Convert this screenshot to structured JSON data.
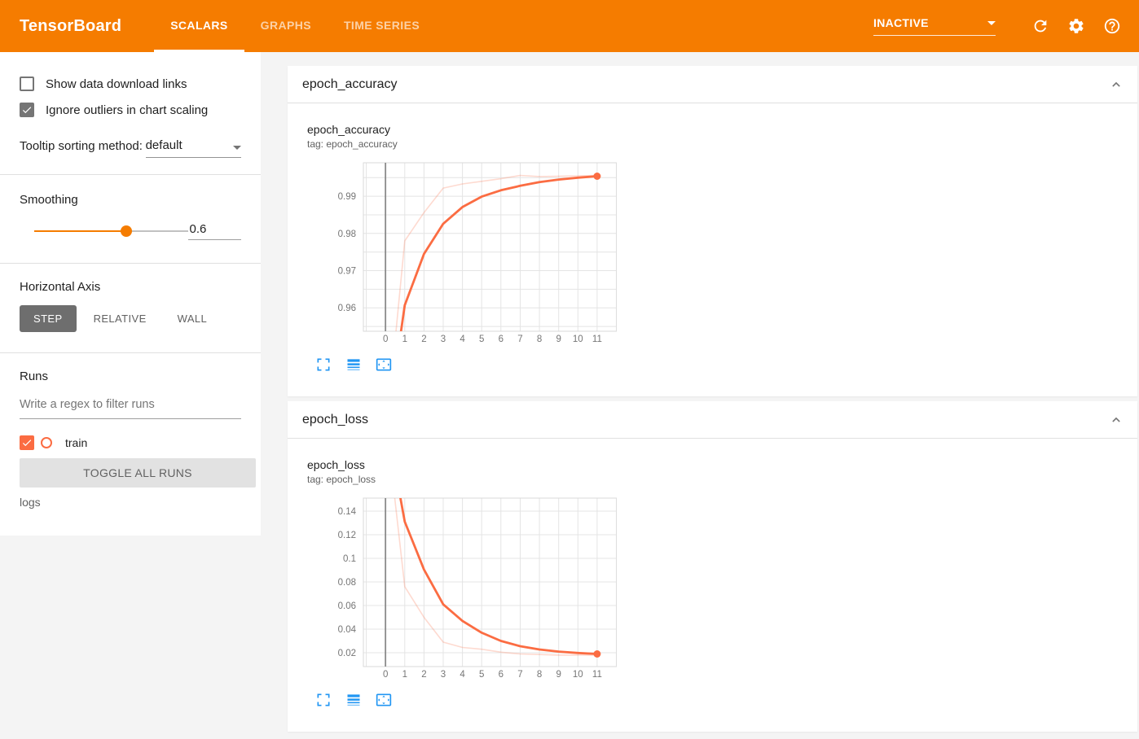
{
  "topbar": {
    "title": "TensorBoard",
    "tabs": [
      {
        "label": "SCALARS",
        "active": true
      },
      {
        "label": "GRAPHS",
        "active": false
      },
      {
        "label": "TIME SERIES",
        "active": false
      }
    ],
    "status_value": "INACTIVE",
    "icons": [
      "dropdown-caret",
      "refresh-icon",
      "settings-gear-icon",
      "help-question-icon"
    ]
  },
  "sidebar": {
    "checkboxes": [
      {
        "label": "Show data download links",
        "checked": false
      },
      {
        "label": "Ignore outliers in chart scaling",
        "checked": true
      }
    ],
    "tooltip_sorting": {
      "label": "Tooltip sorting method:",
      "value": "default"
    },
    "smoothing": {
      "label": "Smoothing",
      "value": "0.6",
      "fraction": 0.6
    },
    "horizontal_axis": {
      "label": "Horizontal Axis",
      "options": [
        {
          "label": "STEP",
          "active": true
        },
        {
          "label": "RELATIVE",
          "active": false
        },
        {
          "label": "WALL",
          "active": false
        }
      ]
    },
    "runs": {
      "label": "Runs",
      "filter_placeholder": "Write a regex to filter runs",
      "items": [
        {
          "name": "train",
          "checked": true,
          "color": "#fb6c42"
        }
      ],
      "toggle_all_label": "TOGGLE ALL RUNS",
      "logdir": "logs"
    }
  },
  "sections": [
    {
      "title": "epoch_accuracy"
    },
    {
      "title": "epoch_loss"
    }
  ],
  "colors": {
    "topbar": "#f57c00",
    "accent": "#f57c00",
    "run": "#fb6c42",
    "action_icon_blue": "#2196f3",
    "grid": "#e4e4e4",
    "axis_line": "#8a8a8a",
    "tick_text": "#757575"
  },
  "chart_data": [
    {
      "type": "line",
      "title": "epoch_accuracy",
      "tag": "tag: epoch_accuracy",
      "xlabel": "step",
      "x": [
        0,
        1,
        2,
        3,
        4,
        5,
        6,
        7,
        8,
        9,
        10,
        11
      ],
      "series": [
        {
          "name": "train",
          "style": "raw",
          "opacity": 0.25,
          "values": [
            0.9247,
            0.978,
            0.9856,
            0.9922,
            0.9933,
            0.994,
            0.9947,
            0.9956,
            0.9953,
            0.9954,
            0.9955,
            0.9956
          ]
        },
        {
          "name": "train (smoothed 0.6)",
          "style": "smoothed",
          "opacity": 1,
          "values": [
            0.9247,
            0.9607,
            0.9745,
            0.9826,
            0.9871,
            0.9899,
            0.9916,
            0.9928,
            0.9938,
            0.9945,
            0.995,
            0.9954
          ]
        }
      ],
      "xlim": [
        -1.15,
        12.02
      ],
      "ylim": [
        0.9537,
        0.999
      ],
      "xticks": [
        0,
        1,
        2,
        3,
        4,
        5,
        6,
        7,
        8,
        9,
        10,
        11
      ],
      "xticklabels": [
        "0",
        "1",
        "2",
        "3",
        "4",
        "5",
        "6",
        "7",
        "8",
        "9",
        "10",
        "11"
      ],
      "yticks": [
        0.96,
        0.97,
        0.98,
        0.99
      ],
      "yticklabels": [
        "0.96",
        "0.97",
        "0.98",
        "0.99"
      ],
      "ygrid_step": 0.005,
      "grid": true,
      "legend": "none",
      "end_dot": true
    },
    {
      "type": "line",
      "title": "epoch_loss",
      "tag": "tag: epoch_loss",
      "xlabel": "step",
      "x": [
        0,
        1,
        2,
        3,
        4,
        5,
        6,
        7,
        8,
        9,
        10,
        11
      ],
      "series": [
        {
          "name": "train",
          "style": "raw",
          "opacity": 0.25,
          "values": [
            0.22,
            0.076,
            0.05,
            0.029,
            0.0245,
            0.023,
            0.0205,
            0.019,
            0.0185,
            0.018,
            0.018,
            0.018
          ]
        },
        {
          "name": "train (smoothed 0.6)",
          "style": "smoothed",
          "opacity": 1,
          "values": [
            0.22,
            0.131,
            0.0905,
            0.061,
            0.047,
            0.037,
            0.03,
            0.0255,
            0.0228,
            0.021,
            0.0198,
            0.019
          ]
        }
      ],
      "xlim": [
        -1.15,
        12.02
      ],
      "ylim": [
        0.0083,
        0.151
      ],
      "xticks": [
        0,
        1,
        2,
        3,
        4,
        5,
        6,
        7,
        8,
        9,
        10,
        11
      ],
      "xticklabels": [
        "0",
        "1",
        "2",
        "3",
        "4",
        "5",
        "6",
        "7",
        "8",
        "9",
        "10",
        "11"
      ],
      "yticks": [
        0.02,
        0.04,
        0.06,
        0.08,
        0.1,
        0.12,
        0.14
      ],
      "yticklabels": [
        "0.02",
        "0.04",
        "0.06",
        "0.08",
        "0.1",
        "0.12",
        "0.14"
      ],
      "ygrid_step": 0.02,
      "grid": true,
      "legend": "none",
      "end_dot": true
    }
  ],
  "chart_actions": [
    "fullscreen-expand-icon",
    "line-weight-log-scale-icon",
    "fit-domain-overscan-icon"
  ]
}
